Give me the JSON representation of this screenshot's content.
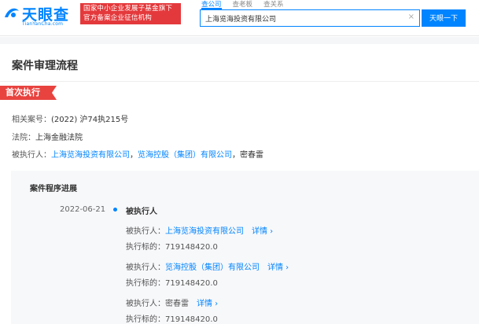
{
  "header": {
    "logo_text": "天眼查",
    "logo_domain": "TianYanCha.com",
    "badge_line1": "国家中小企业发展子基金旗下",
    "badge_line2": "官方备案企业征信机构",
    "search_tabs": [
      "查公司",
      "查老板",
      "查关系"
    ],
    "search_value": "上海览海投资有限公司",
    "search_clear": "×",
    "search_button": "天眼一下"
  },
  "page": {
    "title": "案件审理流程",
    "stage_tag": "首次执行",
    "case_no_label": "相关案号：",
    "case_no_value": "(2022) 沪74执215号",
    "court_label": "法院：",
    "court_value": "上海金融法院",
    "executed_label": "被执行人：",
    "executed_parties": [
      "上海览海投资有限公司",
      "览海控股（集团）有限公司",
      "密春雷"
    ],
    "separator": "，"
  },
  "progress": {
    "title": "案件程序进展",
    "date": "2022-06-21",
    "event_title": "被执行人",
    "entries": [
      {
        "party_label": "被执行人：",
        "party": "上海览海投资有限公司",
        "detail": "详情 ›",
        "target_label": "执行标的：",
        "target_value": "719148420.0"
      },
      {
        "party_label": "被执行人：",
        "party": "览海控股（集团）有限公司",
        "detail": "详情 ›",
        "target_label": "执行标的：",
        "target_value": "719148420.0"
      },
      {
        "party_label": "被执行人：",
        "party": "密春雷",
        "detail": "详情 ›",
        "target_label": "执行标的：",
        "target_value": "719148420.0"
      }
    ]
  },
  "colors": {
    "brand": "#0084ff",
    "stage": "#e8433f",
    "badge": "#e4393c"
  }
}
